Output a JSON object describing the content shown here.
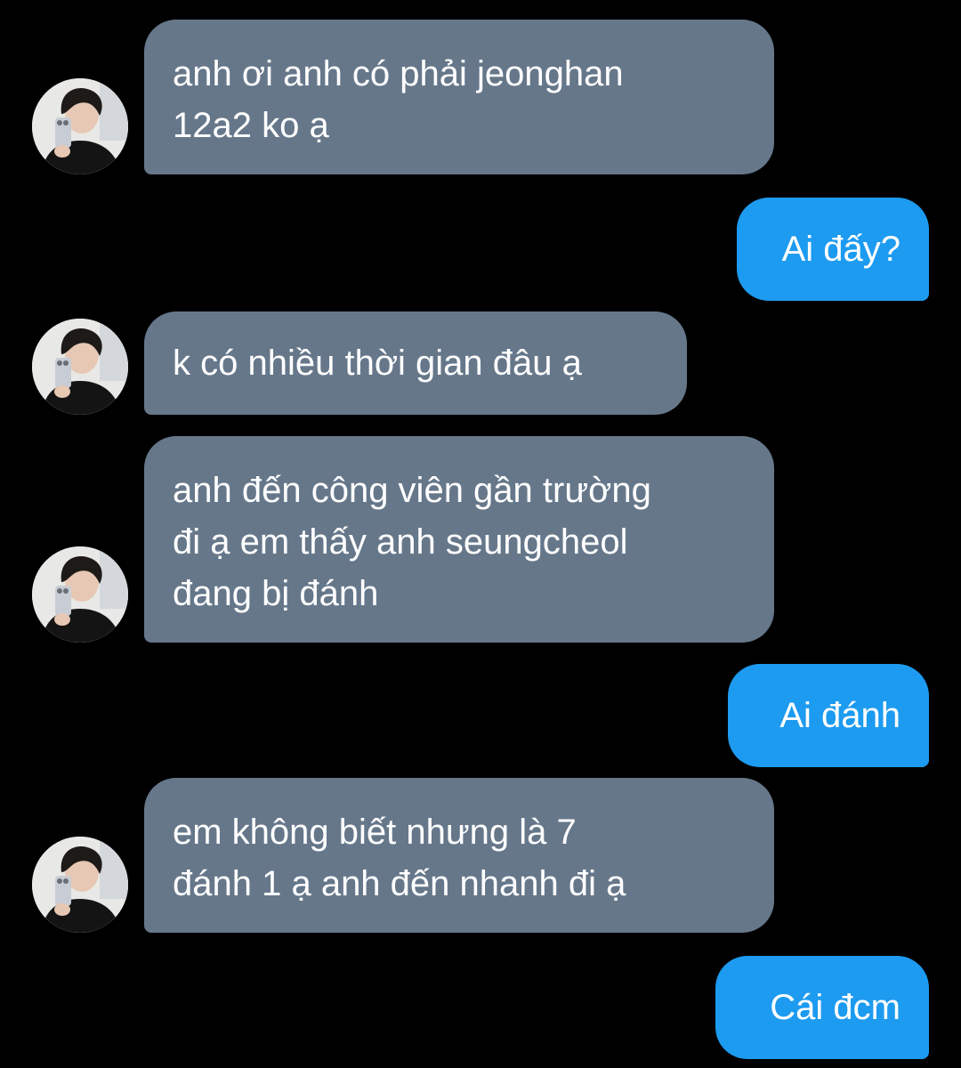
{
  "colors": {
    "background": "#000000",
    "received_bubble": "#66778a",
    "sent_bubble": "#1d9bf0",
    "text": "#ffffff"
  },
  "messages": [
    {
      "side": "received",
      "text": "anh ơi anh có phải jeonghan\n12a2 ko ạ"
    },
    {
      "side": "sent",
      "text": "Ai đấy?"
    },
    {
      "side": "received",
      "text": "k có nhiều thời gian đâu ạ"
    },
    {
      "side": "received",
      "text": "anh đến công viên gần trường\nđi ạ em thấy anh seungcheol\nđang bị đánh"
    },
    {
      "side": "sent",
      "text": "Ai đánh"
    },
    {
      "side": "received",
      "text": "em không biết nhưng là 7\nđánh 1 ạ anh đến nhanh đi ạ"
    },
    {
      "side": "sent",
      "text": "Cái đcm"
    }
  ],
  "avatar": {
    "icon": "user-avatar-photo"
  }
}
